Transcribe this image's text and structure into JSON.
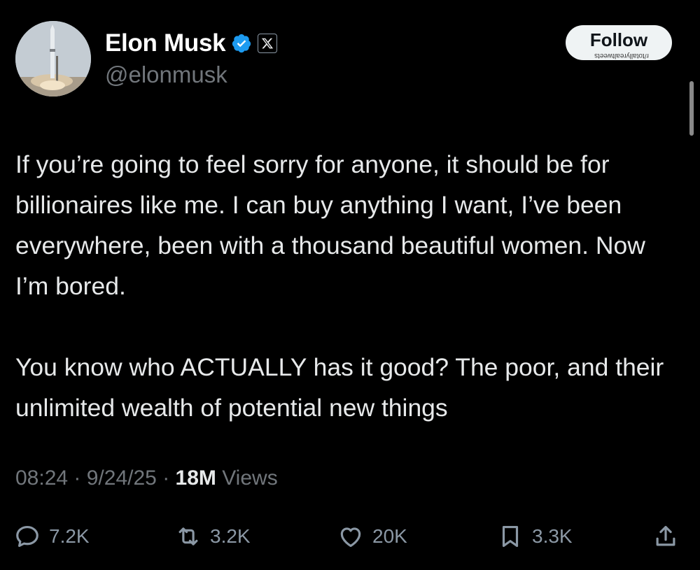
{
  "author": {
    "name": "Elon Musk",
    "handle": "@elonmusk",
    "verified_color": "#1d9bf0",
    "affiliation_icon": "x-logo-icon",
    "avatar_icon": "rocket-launch-avatar"
  },
  "follow_button": {
    "label": "Follow",
    "watermark": "r/totallyrealtweets"
  },
  "tweet": {
    "paragraphs": [
      "If you’re going to feel sorry for anyone, it should be for billionaires like me. I can buy anything I want, I’ve been everywhere, been with a thousand beautiful women. Now I’m bored.",
      "You know who ACTUALLY has it good? The poor, and their unlimited wealth of potential new things"
    ]
  },
  "meta": {
    "time": "08:24",
    "date": "9/24/25",
    "views_count": "18M",
    "views_label": "Views"
  },
  "actions": {
    "replies": "7.2K",
    "reposts": "3.2K",
    "likes": "20K",
    "bookmarks": "3.3K"
  }
}
